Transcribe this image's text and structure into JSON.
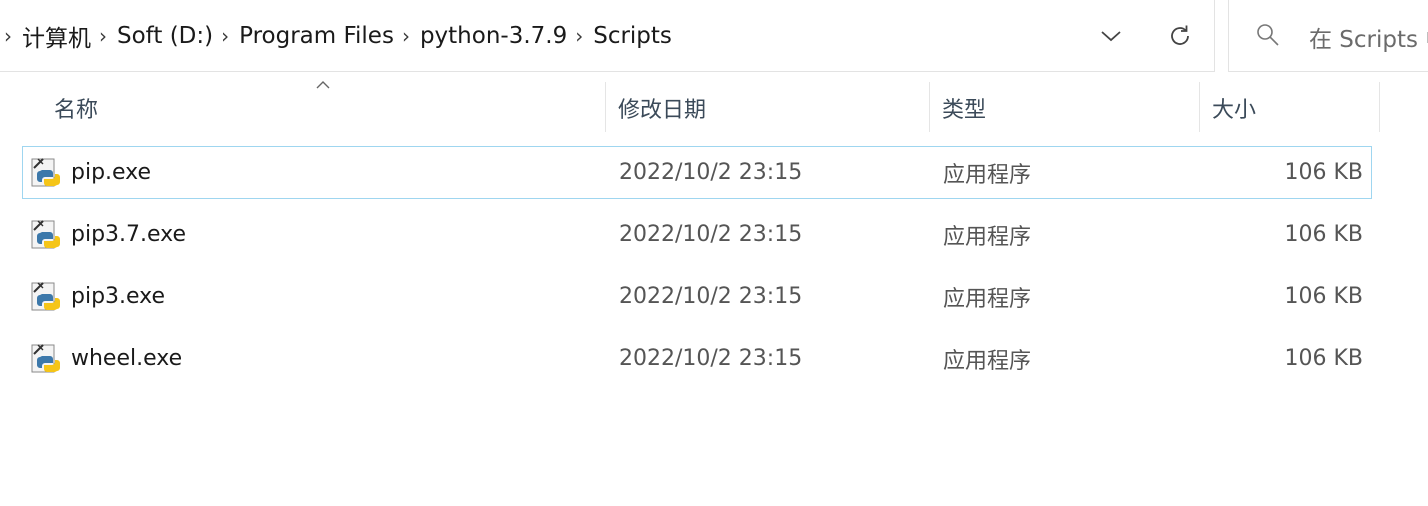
{
  "address_bar": {
    "breadcrumb": [
      "计算机",
      "Soft (D:)",
      "Program Files",
      "python-3.7.9",
      "Scripts"
    ]
  },
  "search": {
    "placeholder": "在 Scripts 中"
  },
  "columns": {
    "name": "名称",
    "date": "修改日期",
    "type": "类型",
    "size": "大小"
  },
  "files": [
    {
      "name": "pip.exe",
      "date": "2022/10/2 23:15",
      "type": "应用程序",
      "size": "106 KB",
      "selected": true
    },
    {
      "name": "pip3.7.exe",
      "date": "2022/10/2 23:15",
      "type": "应用程序",
      "size": "106 KB",
      "selected": false
    },
    {
      "name": "pip3.exe",
      "date": "2022/10/2 23:15",
      "type": "应用程序",
      "size": "106 KB",
      "selected": false
    },
    {
      "name": "wheel.exe",
      "date": "2022/10/2 23:15",
      "type": "应用程序",
      "size": "106 KB",
      "selected": false
    }
  ],
  "icons": {
    "file": "python-executable-icon",
    "dropdown": "chevron-down-icon",
    "refresh": "refresh-icon",
    "search": "search-icon",
    "sort": "sort-ascending-icon"
  },
  "colors": {
    "selection_border": "#9fd6f0",
    "python_blue": "#3c78aa",
    "python_yellow": "#f5c518"
  }
}
